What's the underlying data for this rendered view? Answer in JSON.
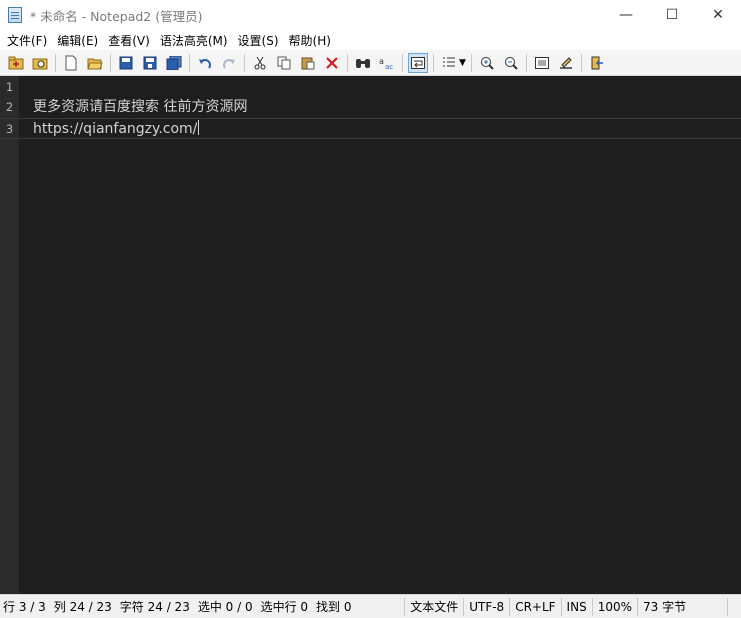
{
  "window": {
    "title": "* 未命名 - Notepad2 (管理员)",
    "controls": {
      "minimize": "—",
      "maximize": "☐",
      "close": "✕"
    }
  },
  "menu": [
    "文件(F)",
    "编辑(E)",
    "查看(V)",
    "语法高亮(M)",
    "设置(S)",
    "帮助(H)"
  ],
  "toolbar": {
    "icons": [
      "new-folder-icon",
      "browse-icon",
      "new-file-icon",
      "open-folder-icon",
      "save-icon",
      "save-as-icon",
      "save-copy-icon",
      "undo-icon",
      "redo-icon",
      "cut-icon",
      "copy-icon",
      "paste-icon",
      "delete-icon",
      "find-icon",
      "replace-icon",
      "word-wrap-icon",
      "view-options-icon",
      "zoom-in-icon",
      "zoom-out-icon",
      "scheme-icon",
      "customize-icon",
      "exit-icon"
    ],
    "active": "word-wrap-icon"
  },
  "editor": {
    "background": "#1e1e1e",
    "text_color": "#d4d4d4",
    "current_line": 3,
    "lines": [
      {
        "num": "1",
        "text": ""
      },
      {
        "num": "2",
        "text": "更多资源请百度搜索 往前方资源网"
      },
      {
        "num": "3",
        "text": "https://qianfangzy.com/"
      }
    ]
  },
  "status": {
    "line": "行 3 / 3",
    "col": "列 24 / 23",
    "chars": "字符 24 / 23",
    "sel": "选中 0 / 0",
    "sel_lines": "选中行 0",
    "found": "找到 0",
    "doc_type": "文本文件",
    "encoding": "UTF-8",
    "eol": "CR+LF",
    "ovr": "INS",
    "zoom": "100%",
    "size": "73 字节"
  }
}
